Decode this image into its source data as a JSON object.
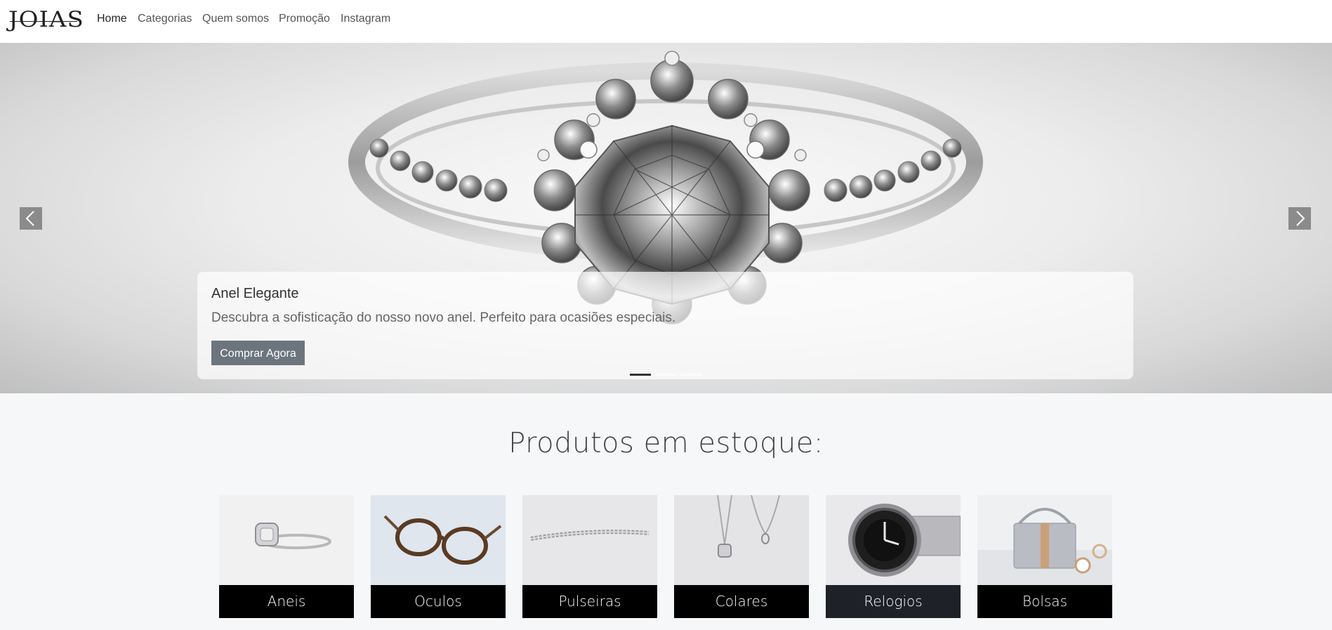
{
  "nav": {
    "brand": "JOIAS",
    "items": [
      {
        "label": "Home",
        "active": true
      },
      {
        "label": "Categorias",
        "active": false
      },
      {
        "label": "Quem somos",
        "active": false
      },
      {
        "label": "Promoção",
        "active": false
      },
      {
        "label": "Instagram",
        "active": false
      }
    ]
  },
  "carousel": {
    "slide": {
      "title": "Anel Elegante",
      "description": "Descubra a sofisticação do nosso novo anel. Perfeito para ocasiões especiais.",
      "button": "Comprar Agora"
    },
    "indicators": 3,
    "active_index": 0,
    "prev_icon": "chevron-left-icon",
    "next_icon": "chevron-right-icon"
  },
  "products": {
    "title": "Produtos em estoque:",
    "items": [
      {
        "label": "Aneis",
        "image": "ring"
      },
      {
        "label": "Oculos",
        "image": "glasses"
      },
      {
        "label": "Pulseiras",
        "image": "bracelet"
      },
      {
        "label": "Colares",
        "image": "necklace"
      },
      {
        "label": "Relogios",
        "image": "watch"
      },
      {
        "label": "Bolsas",
        "image": "bag"
      }
    ]
  },
  "colors": {
    "button": "#6c757d",
    "label_bg": "#000000",
    "label_bg_hover": "#1e2228",
    "page_bg": "#f6f7f9"
  }
}
